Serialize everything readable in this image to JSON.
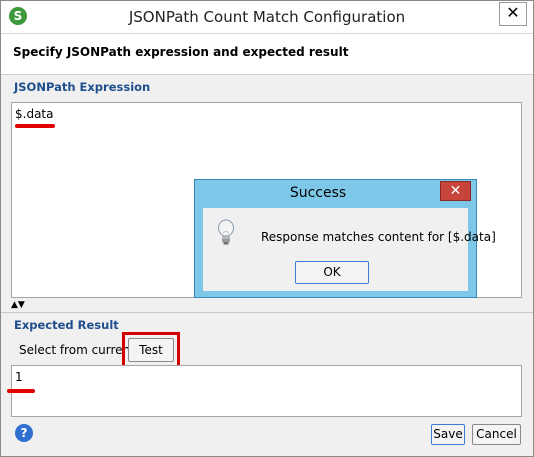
{
  "window": {
    "title": "JSONPath Count Match Configuration",
    "close_glyph": "✕"
  },
  "header": {
    "text": "Specify JSONPath expression and expected result"
  },
  "expression": {
    "label": "JSONPath Expression",
    "value": "$.data"
  },
  "expected": {
    "label": "Expected Result",
    "select_label": "Select from current",
    "test_label": "Test",
    "value": "1"
  },
  "footer": {
    "save_label": "Save",
    "cancel_label": "Cancel",
    "help_glyph": "?"
  },
  "dialog": {
    "title": "Success",
    "message": "Response matches content for [$.data]",
    "ok_label": "OK",
    "close_glyph": "✕"
  },
  "colors": {
    "annotation_red": "#e00000",
    "dialog_frame": "#7dc8e8",
    "section_label": "#1f4e8c"
  },
  "icons": [
    "app-icon",
    "close-icon",
    "expand-collapse-icon",
    "help-icon",
    "lightbulb-icon"
  ]
}
